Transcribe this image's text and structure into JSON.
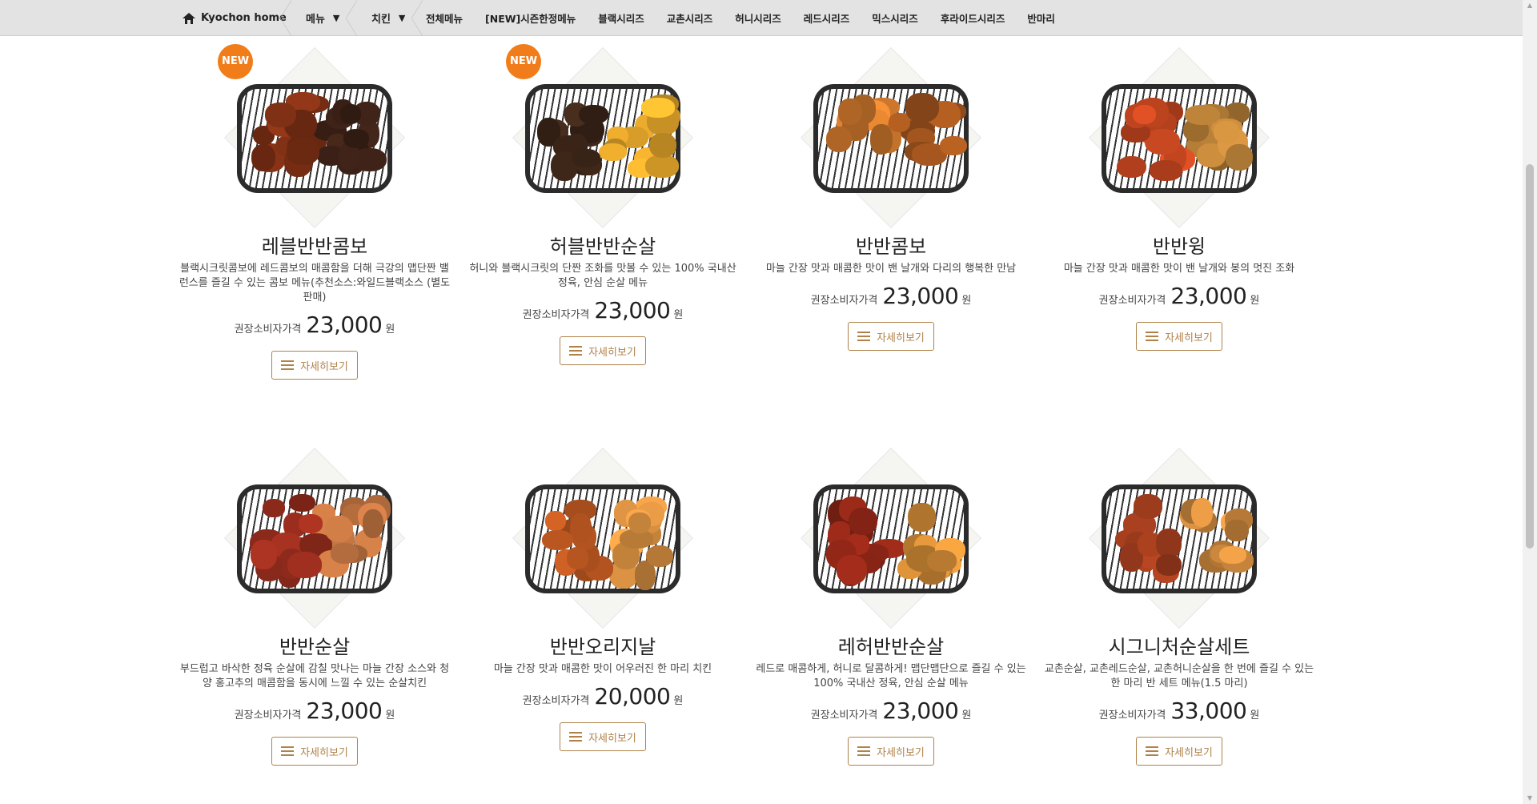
{
  "nav": {
    "home": "Kyochon home",
    "menu_label": "메뉴",
    "category_label": "치킨",
    "dropdown_glyph": "▼",
    "links": [
      "전체메뉴",
      "[NEW]시즌한정메뉴",
      "블랙시리즈",
      "교촌시리즈",
      "허니시리즈",
      "레드시리즈",
      "믹스시리즈",
      "후라이드시리즈",
      "반마리"
    ]
  },
  "common": {
    "price_label": "권장소비자가격",
    "currency": "원",
    "detail_label": "자세히보기",
    "new_label": "NEW"
  },
  "products": [
    {
      "name": "레블반반콤보",
      "desc": "블랙시크릿콤보에 레드콤보의 매콤함을 더해 극강의 맵단짠 밸런스를 즐길 수 있는 콤보 메뉴(추천소스:와일드블랙소스 (별도판매)",
      "price": "23,000",
      "is_new": true,
      "colors": [
        "#7a2e14",
        "#3a2016"
      ]
    },
    {
      "name": "허블반반순살",
      "desc": "허니와 블랙시크릿의 단짠 조화를 맛볼 수 있는 100% 국내산 정육, 안심 순살 메뉴",
      "price": "23,000",
      "is_new": true,
      "colors": [
        "#3b2518",
        "#e0a32a"
      ]
    },
    {
      "name": "반반콤보",
      "desc": "마늘 간장 맛과 매콤한 맛이 밴 날개와 다리의 행복한 만남",
      "price": "23,000",
      "is_new": false,
      "colors": [
        "#c9752c",
        "#a2551e"
      ]
    },
    {
      "name": "반반윙",
      "desc": "마늘 간장 맛과 매콤한 맛이 밴 날개와 봉의 멋진 조화",
      "price": "23,000",
      "is_new": false,
      "colors": [
        "#b9421e",
        "#b07a35"
      ]
    },
    {
      "name": "반반순살",
      "desc": "부드럽고 바삭한 정육 순살에 감칠 맛나는 마늘 간장 소스와 청양 홍고추의 매콤함을 동시에 느낄 수 있는 순살치킨",
      "price": "23,000",
      "is_new": false,
      "colors": [
        "#8e2a1c",
        "#b06a3c"
      ]
    },
    {
      "name": "반반오리지날",
      "desc": "마늘 간장 맛과 매콤한 맛이 어우러진 한 마리 치킨",
      "price": "20,000",
      "is_new": false,
      "colors": [
        "#b45420",
        "#cf8a3e"
      ]
    },
    {
      "name": "레허반반순살",
      "desc": "레드로 매콤하게, 허니로 달콤하게! 맵단맵단으로 즐길 수 있는 100% 국내산 정육, 안심 순살 메뉴",
      "price": "23,000",
      "is_new": false,
      "colors": [
        "#8a2516",
        "#d08a36"
      ]
    },
    {
      "name": "시그니처순살세트",
      "desc": "교촌순살, 교촌레드순살, 교촌허니순살을 한 번에 즐길 수 있는 한 마리 반 세트 메뉴(1.5 마리)",
      "price": "33,000",
      "is_new": false,
      "colors": [
        "#9a3a1c",
        "#c8853c"
      ]
    }
  ]
}
